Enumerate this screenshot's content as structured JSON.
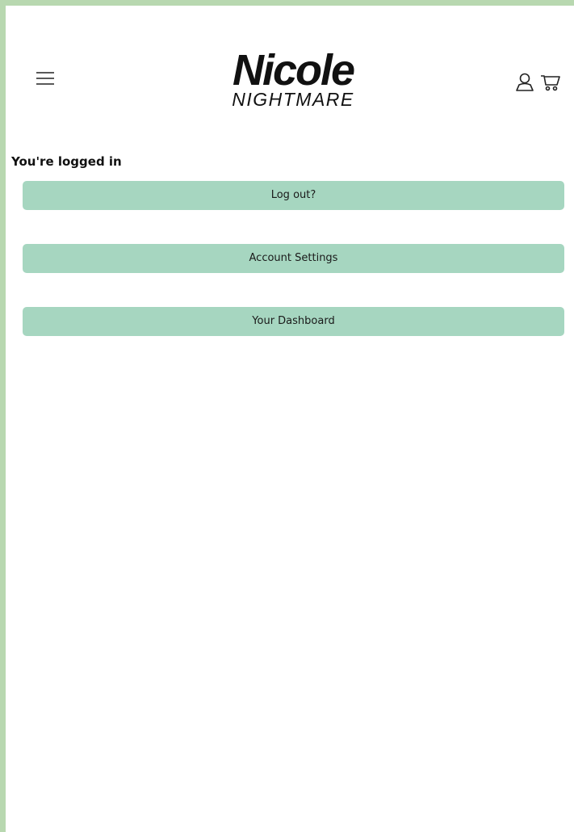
{
  "header": {
    "menu_icon": "hamburger-menu-icon",
    "logo": {
      "main": "Nicole",
      "sub": "NIGHTMARE"
    },
    "user_icon": "user-icon",
    "cart_icon": "shopping-cart-icon"
  },
  "main": {
    "status": "You're logged in",
    "buttons": [
      {
        "label": "Log out?"
      },
      {
        "label": "Account Settings"
      },
      {
        "label": "Your Dashboard"
      }
    ]
  },
  "colors": {
    "outer_border": "#b8d8b0",
    "button_bg": "#a6d6c0",
    "text": "#111111"
  }
}
